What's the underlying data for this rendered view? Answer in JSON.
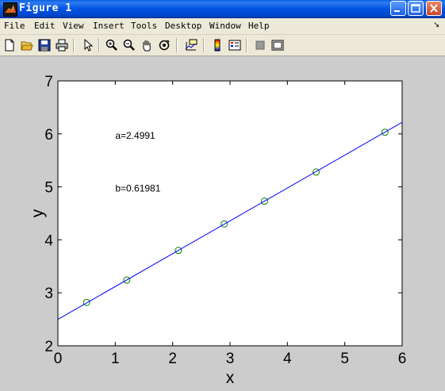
{
  "window": {
    "title": "Figure 1"
  },
  "menu": {
    "items": [
      "File",
      "Edit",
      "View",
      "Insert",
      "Tools",
      "Desktop",
      "Window",
      "Help"
    ],
    "overflow_glyph": "↘"
  },
  "toolbar": {
    "buttons": [
      "new-figure-icon",
      "open-file-icon",
      "save-icon",
      "print-icon",
      "edit-plot-arrow-icon",
      "zoom-in-icon",
      "zoom-out-icon",
      "pan-hand-icon",
      "rotate-3d-icon",
      "data-cursor-icon",
      "colorbar-icon",
      "legend-icon",
      "hide-plot-tools-icon",
      "show-plot-tools-icon"
    ]
  },
  "chart_data": {
    "type": "scatter",
    "xlabel": "x",
    "ylabel": "y",
    "xlim": [
      0,
      6
    ],
    "ylim": [
      2,
      7
    ],
    "xticks": [
      "0",
      "1",
      "2",
      "3",
      "4",
      "5",
      "6"
    ],
    "yticks": [
      "2",
      "3",
      "4",
      "5",
      "6",
      "7"
    ],
    "grid": false,
    "series": [
      {
        "type": "scatter",
        "marker": "circle",
        "color": "#008000",
        "x": [
          0.5,
          1.2,
          2.1,
          2.9,
          3.6,
          4.5,
          5.7
        ],
        "y": [
          2.82,
          3.24,
          3.8,
          4.3,
          4.73,
          5.28,
          6.03
        ]
      },
      {
        "type": "line",
        "color": "#0000FF",
        "x": [
          0,
          6
        ],
        "y": [
          2.4991,
          6.218
        ]
      }
    ],
    "annotations": [
      {
        "text": "a=2.4991",
        "x": 1.0,
        "y": 5.97
      },
      {
        "text": "b=0.61981",
        "x": 1.0,
        "y": 4.97
      }
    ]
  }
}
